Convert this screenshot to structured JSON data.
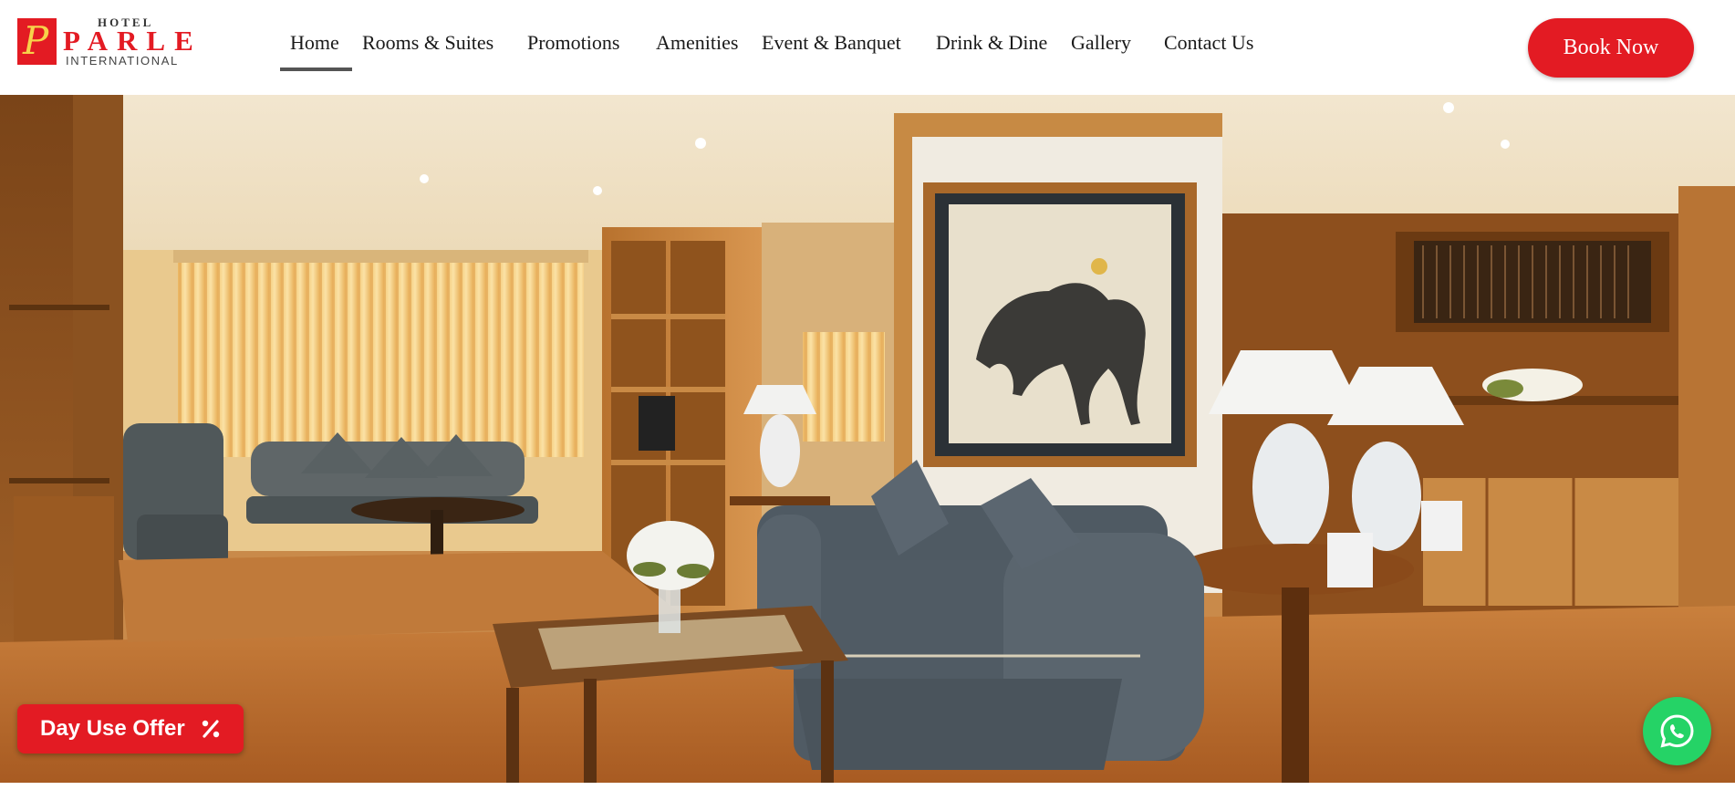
{
  "logo": {
    "hotel": "HOTEL",
    "brand": "PARLE",
    "sub": "INTERNATIONAL",
    "monogram": "P"
  },
  "nav": {
    "items": [
      {
        "label": "Home",
        "active": true
      },
      {
        "label": "Rooms & Suites"
      },
      {
        "label": "Promotions"
      },
      {
        "label": "Amenities"
      },
      {
        "label": "Event & Banquet"
      },
      {
        "label": "Drink & Dine"
      },
      {
        "label": "Gallery"
      },
      {
        "label": "Contact Us"
      }
    ]
  },
  "cta": {
    "book_now": "Book Now"
  },
  "offer": {
    "label": "Day Use Offer",
    "icon": "percent-icon"
  },
  "whatsapp": {
    "icon": "whatsapp-icon"
  },
  "hero": {
    "image": "hotel-suite-living-room"
  },
  "colors": {
    "brand_red": "#e31b23",
    "whatsapp_green": "#25d366",
    "nav_text": "#1a1a1a"
  }
}
